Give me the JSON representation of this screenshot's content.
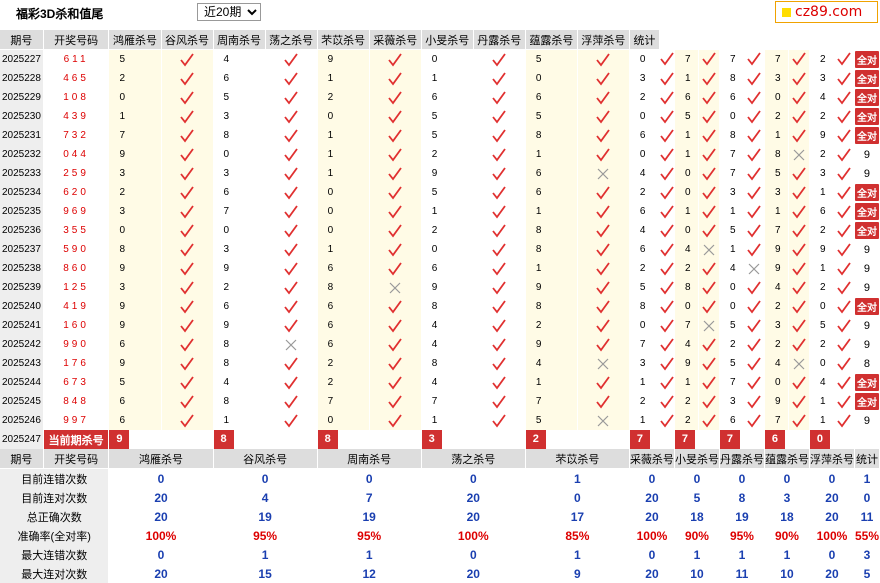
{
  "header": {
    "title": "福彩3D杀和值尾",
    "period_select": "近20期",
    "logo_text": "cz89.com"
  },
  "columns": [
    "期号",
    "开奖号码",
    "鸿雁杀号",
    "谷风杀号",
    "周南杀号",
    "荡之杀号",
    "芣苡杀号",
    "采薇杀号",
    "小旻杀号",
    "丹露杀号",
    "蕴露杀号",
    "浮萍杀号",
    "统计"
  ],
  "rows": [
    {
      "period": "2025227",
      "draw": "611",
      "kills": [
        "5",
        "4",
        "9",
        "0",
        "5",
        "0",
        "7",
        "7",
        "7",
        "2"
      ],
      "hits": [
        1,
        1,
        1,
        1,
        1,
        1,
        1,
        1,
        1,
        1
      ],
      "stat": "全对"
    },
    {
      "period": "2025228",
      "draw": "465",
      "kills": [
        "2",
        "6",
        "1",
        "1",
        "0",
        "3",
        "1",
        "8",
        "3",
        "3"
      ],
      "hits": [
        1,
        1,
        1,
        1,
        1,
        1,
        1,
        1,
        1,
        1
      ],
      "stat": "全对"
    },
    {
      "period": "2025229",
      "draw": "108",
      "kills": [
        "0",
        "5",
        "2",
        "6",
        "6",
        "2",
        "6",
        "6",
        "0",
        "4"
      ],
      "hits": [
        1,
        1,
        1,
        1,
        1,
        1,
        1,
        1,
        1,
        1
      ],
      "stat": "全对"
    },
    {
      "period": "2025230",
      "draw": "439",
      "kills": [
        "1",
        "3",
        "0",
        "5",
        "5",
        "0",
        "5",
        "0",
        "2",
        "2"
      ],
      "hits": [
        1,
        1,
        1,
        1,
        1,
        1,
        1,
        1,
        1,
        1
      ],
      "stat": "全对"
    },
    {
      "period": "2025231",
      "draw": "732",
      "kills": [
        "7",
        "8",
        "1",
        "5",
        "8",
        "6",
        "1",
        "8",
        "1",
        "9"
      ],
      "hits": [
        1,
        1,
        1,
        1,
        1,
        1,
        1,
        1,
        1,
        1
      ],
      "stat": "全对"
    },
    {
      "period": "2025232",
      "draw": "044",
      "kills": [
        "9",
        "0",
        "1",
        "2",
        "1",
        "0",
        "1",
        "7",
        "8",
        "2"
      ],
      "hits": [
        1,
        1,
        1,
        1,
        1,
        1,
        1,
        1,
        0,
        1
      ],
      "stat": "9"
    },
    {
      "period": "2025233",
      "draw": "259",
      "kills": [
        "3",
        "3",
        "1",
        "9",
        "6",
        "4",
        "0",
        "7",
        "5",
        "3"
      ],
      "hits": [
        1,
        1,
        1,
        1,
        0,
        1,
        1,
        1,
        1,
        1
      ],
      "stat": "9"
    },
    {
      "period": "2025234",
      "draw": "620",
      "kills": [
        "2",
        "6",
        "0",
        "5",
        "6",
        "2",
        "0",
        "3",
        "3",
        "1"
      ],
      "hits": [
        1,
        1,
        1,
        1,
        1,
        1,
        1,
        1,
        1,
        1
      ],
      "stat": "全对"
    },
    {
      "period": "2025235",
      "draw": "969",
      "kills": [
        "3",
        "7",
        "0",
        "1",
        "1",
        "6",
        "1",
        "1",
        "1",
        "6"
      ],
      "hits": [
        1,
        1,
        1,
        1,
        1,
        1,
        1,
        1,
        1,
        1
      ],
      "stat": "全对"
    },
    {
      "period": "2025236",
      "draw": "355",
      "kills": [
        "0",
        "0",
        "0",
        "2",
        "8",
        "4",
        "0",
        "5",
        "7",
        "2"
      ],
      "hits": [
        1,
        1,
        1,
        1,
        1,
        1,
        1,
        1,
        1,
        1
      ],
      "stat": "全对"
    },
    {
      "period": "2025237",
      "draw": "590",
      "kills": [
        "8",
        "3",
        "1",
        "0",
        "8",
        "6",
        "4",
        "1",
        "9",
        "9"
      ],
      "hits": [
        1,
        1,
        1,
        1,
        1,
        1,
        0,
        1,
        1,
        1
      ],
      "stat": "9"
    },
    {
      "period": "2025238",
      "draw": "860",
      "kills": [
        "9",
        "9",
        "6",
        "6",
        "1",
        "2",
        "2",
        "4",
        "9",
        "1"
      ],
      "hits": [
        1,
        1,
        1,
        1,
        1,
        1,
        1,
        0,
        1,
        1
      ],
      "stat": "9"
    },
    {
      "period": "2025239",
      "draw": "125",
      "kills": [
        "3",
        "2",
        "8",
        "9",
        "9",
        "5",
        "8",
        "0",
        "4",
        "2"
      ],
      "hits": [
        1,
        1,
        0,
        1,
        1,
        1,
        1,
        1,
        1,
        1
      ],
      "stat": "9"
    },
    {
      "period": "2025240",
      "draw": "419",
      "kills": [
        "9",
        "6",
        "6",
        "8",
        "8",
        "8",
        "0",
        "0",
        "2",
        "0"
      ],
      "hits": [
        1,
        1,
        1,
        1,
        1,
        1,
        1,
        1,
        1,
        1
      ],
      "stat": "全对"
    },
    {
      "period": "2025241",
      "draw": "160",
      "kills": [
        "9",
        "9",
        "6",
        "4",
        "2",
        "0",
        "7",
        "5",
        "3",
        "5"
      ],
      "hits": [
        1,
        1,
        1,
        1,
        1,
        1,
        0,
        1,
        1,
        1
      ],
      "stat": "9"
    },
    {
      "period": "2025242",
      "draw": "990",
      "kills": [
        "6",
        "8",
        "6",
        "4",
        "9",
        "7",
        "4",
        "2",
        "2",
        "2"
      ],
      "hits": [
        1,
        0,
        1,
        1,
        1,
        1,
        1,
        1,
        1,
        1
      ],
      "stat": "9"
    },
    {
      "period": "2025243",
      "draw": "176",
      "kills": [
        "9",
        "8",
        "2",
        "8",
        "4",
        "3",
        "9",
        "5",
        "4",
        "0"
      ],
      "hits": [
        1,
        1,
        1,
        1,
        0,
        1,
        1,
        1,
        0,
        1
      ],
      "stat": "8"
    },
    {
      "period": "2025244",
      "draw": "673",
      "kills": [
        "5",
        "4",
        "2",
        "4",
        "1",
        "1",
        "1",
        "7",
        "0",
        "4"
      ],
      "hits": [
        1,
        1,
        1,
        1,
        1,
        1,
        1,
        1,
        1,
        1
      ],
      "stat": "全对"
    },
    {
      "period": "2025245",
      "draw": "848",
      "kills": [
        "6",
        "8",
        "7",
        "7",
        "7",
        "2",
        "2",
        "3",
        "9",
        "1"
      ],
      "hits": [
        1,
        1,
        1,
        1,
        1,
        1,
        1,
        1,
        1,
        1
      ],
      "stat": "全对"
    },
    {
      "period": "2025246",
      "draw": "997",
      "kills": [
        "6",
        "1",
        "0",
        "1",
        "5",
        "1",
        "2",
        "6",
        "7",
        "1"
      ],
      "hits": [
        1,
        1,
        1,
        1,
        0,
        1,
        1,
        1,
        1,
        1
      ],
      "stat": "9"
    }
  ],
  "current": {
    "period": "2025247",
    "label": "当前期杀号",
    "kills": [
      "9",
      "8",
      "8",
      "3",
      "2",
      "7",
      "7",
      "7",
      "6",
      "0"
    ]
  },
  "summary": {
    "header": [
      "期号",
      "开奖号码",
      "鸿雁杀号",
      "谷风杀号",
      "周南杀号",
      "荡之杀号",
      "芣苡杀号",
      "采薇杀号",
      "小旻杀号",
      "丹露杀号",
      "蕴露杀号",
      "浮萍杀号",
      "统计"
    ],
    "rows": [
      {
        "label": "目前连错次数",
        "values": [
          "0",
          "0",
          "0",
          "0",
          "1",
          "0",
          "0",
          "0",
          "0",
          "0",
          "1"
        ],
        "red": false
      },
      {
        "label": "目前连对次数",
        "values": [
          "20",
          "4",
          "7",
          "20",
          "0",
          "20",
          "5",
          "8",
          "3",
          "20",
          "0"
        ],
        "red": false
      },
      {
        "label": "总正确次数",
        "values": [
          "20",
          "19",
          "19",
          "20",
          "17",
          "20",
          "18",
          "19",
          "18",
          "20",
          "11"
        ],
        "red": false
      },
      {
        "label": "准确率(全对率)",
        "values": [
          "100%",
          "95%",
          "95%",
          "100%",
          "85%",
          "100%",
          "90%",
          "95%",
          "90%",
          "100%",
          "55%"
        ],
        "red": true
      },
      {
        "label": "最大连错次数",
        "values": [
          "0",
          "1",
          "1",
          "0",
          "1",
          "0",
          "1",
          "1",
          "1",
          "0",
          "3"
        ],
        "red": false
      },
      {
        "label": "最大连对次数",
        "values": [
          "20",
          "15",
          "12",
          "20",
          "9",
          "20",
          "10",
          "11",
          "10",
          "20",
          "5"
        ],
        "red": false
      }
    ]
  },
  "colors": {
    "accent_red": "#d03030",
    "tick_red": "#e03030",
    "cross_gray": "#999999",
    "value_blue": "#1a3fb0"
  }
}
